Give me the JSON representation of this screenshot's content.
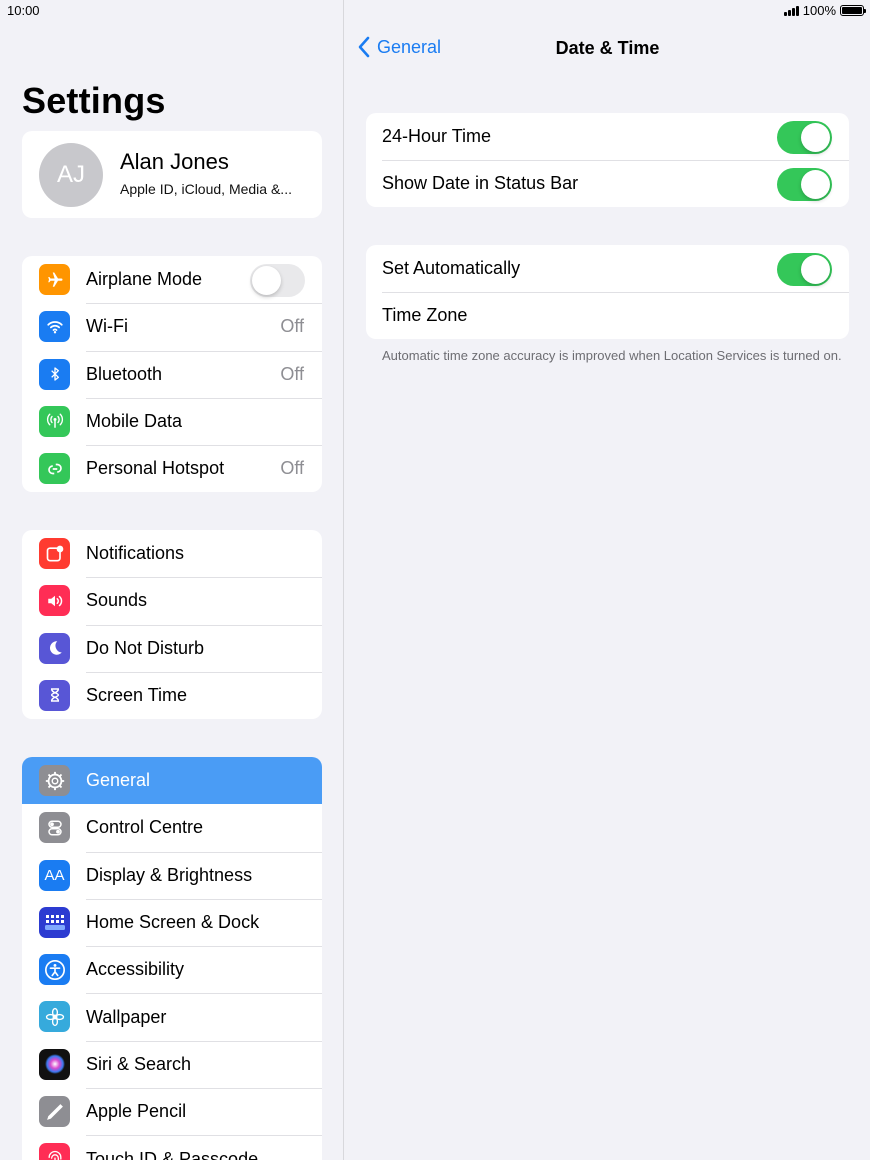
{
  "status_bar": {
    "time": "10:00",
    "battery": "100%"
  },
  "sidebar": {
    "title": "Settings",
    "profile": {
      "initials": "AJ",
      "name": "Alan Jones",
      "subtitle": "Apple ID, iCloud, Media &..."
    },
    "group1": [
      {
        "label": "Airplane Mode",
        "icon": "airplane-icon",
        "color": "#ff9500",
        "toggle": false
      },
      {
        "label": "Wi-Fi",
        "icon": "wifi-icon",
        "color": "#1a7cf2",
        "value": "Off"
      },
      {
        "label": "Bluetooth",
        "icon": "bluetooth-icon",
        "color": "#1a7cf2",
        "value": "Off"
      },
      {
        "label": "Mobile Data",
        "icon": "antenna-icon",
        "color": "#34c759"
      },
      {
        "label": "Personal Hotspot",
        "icon": "hotspot-icon",
        "color": "#34c759",
        "value": "Off"
      }
    ],
    "group2": [
      {
        "label": "Notifications",
        "icon": "notifications-icon",
        "color": "#ff3b30"
      },
      {
        "label": "Sounds",
        "icon": "speaker-icon",
        "color": "#ff2d55"
      },
      {
        "label": "Do Not Disturb",
        "icon": "moon-icon",
        "color": "#5856d6"
      },
      {
        "label": "Screen Time",
        "icon": "hourglass-icon",
        "color": "#5856d6"
      }
    ],
    "group3": [
      {
        "label": "General",
        "icon": "gear-icon",
        "color": "#8e8e93",
        "selected": true
      },
      {
        "label": "Control Centre",
        "icon": "switches-icon",
        "color": "#8e8e93"
      },
      {
        "label": "Display & Brightness",
        "icon": "text-size-icon",
        "color": "#1a7cf2"
      },
      {
        "label": "Home Screen & Dock",
        "icon": "grid-icon",
        "color": "#2c3bd1"
      },
      {
        "label": "Accessibility",
        "icon": "accessibility-icon",
        "color": "#1a7cf2"
      },
      {
        "label": "Wallpaper",
        "icon": "flower-icon",
        "color": "#36aadc"
      },
      {
        "label": "Siri & Search",
        "icon": "siri-icon",
        "color": "#222"
      },
      {
        "label": "Apple Pencil",
        "icon": "pencil-icon",
        "color": "#8e8e93"
      },
      {
        "label": "Touch ID & Passcode",
        "icon": "fingerprint-icon",
        "color": "#ff2d55"
      }
    ]
  },
  "detail": {
    "back_label": "General",
    "title": "Date & Time",
    "group1": [
      {
        "label": "24-Hour Time",
        "toggle": true
      },
      {
        "label": "Show Date in Status Bar",
        "toggle": true
      }
    ],
    "group2": [
      {
        "label": "Set Automatically",
        "toggle": true
      },
      {
        "label": "Time Zone"
      }
    ],
    "footnote": "Automatic time zone accuracy is improved when Location Services is turned on."
  },
  "colors": {
    "accent": "#1a7cf2",
    "toggle_on": "#34c759",
    "selected_row": "#4a9cf5"
  }
}
